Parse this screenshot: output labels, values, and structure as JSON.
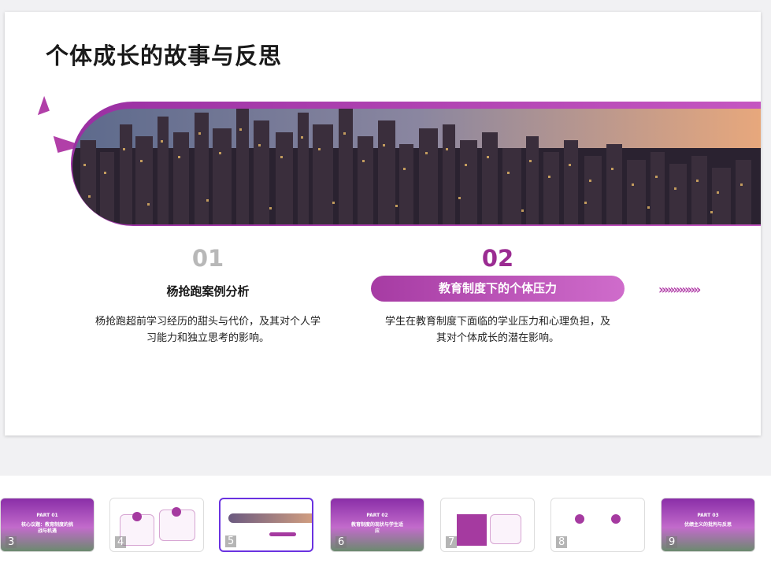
{
  "slide": {
    "title": "个体成长的故事与反思",
    "items": [
      {
        "number": "01",
        "title": "杨抢跑案例分析",
        "description_lines": [
          "杨抢跑超前学习经历的甜头与代价，及其对个人学",
          "习能力和独立思考的影响。"
        ]
      },
      {
        "number": "02",
        "title": "教育制度下的个体压力",
        "description_lines": [
          "学生在教育制度下面临的学业压力和心理负担，及",
          "其对个体成长的潜在影响。"
        ]
      }
    ],
    "arrows": "»»»»»»»"
  },
  "thumbnails": [
    {
      "number": "3",
      "type": "part",
      "line1": "PART 01",
      "line2": "核心议题：教育制度的挑",
      "line3": "战与机遇"
    },
    {
      "number": "4",
      "type": "white"
    },
    {
      "number": "5",
      "type": "white",
      "active": true
    },
    {
      "number": "6",
      "type": "part",
      "line1": "PART 02",
      "line2": "教育制度的现状与学生适",
      "line3": "应"
    },
    {
      "number": "7",
      "type": "white"
    },
    {
      "number": "8",
      "type": "white"
    },
    {
      "number": "9",
      "type": "part",
      "line1": "PART 03",
      "line2": "优绩主义的批判与反思",
      "line3": ""
    }
  ],
  "colors": {
    "accent": "#a63ba3",
    "accent_light": "#cf6ccb",
    "active_thumb": "#6a32e0"
  }
}
